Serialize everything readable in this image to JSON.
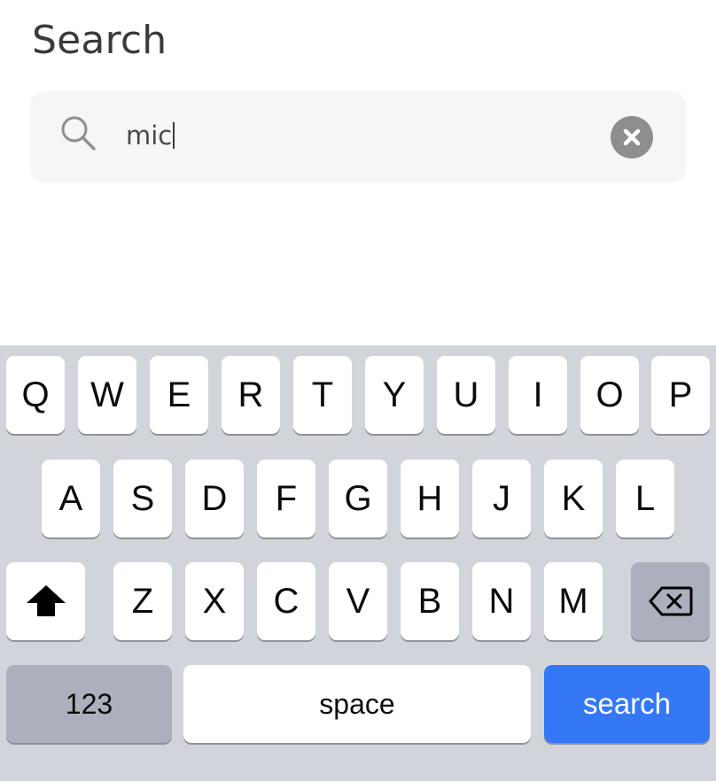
{
  "header": {
    "title": "Search"
  },
  "search": {
    "query": "mic"
  },
  "keyboard": {
    "row1": [
      "Q",
      "W",
      "E",
      "R",
      "T",
      "Y",
      "U",
      "I",
      "O",
      "P"
    ],
    "row2": [
      "A",
      "S",
      "D",
      "F",
      "G",
      "H",
      "J",
      "K",
      "L"
    ],
    "row3": [
      "Z",
      "X",
      "C",
      "V",
      "B",
      "N",
      "M"
    ],
    "numbers_label": "123",
    "space_label": "space",
    "search_label": "search"
  },
  "icons": {
    "search": "search-icon",
    "clear": "clear-icon",
    "shift": "shift-arrow-icon",
    "backspace": "backspace-icon"
  },
  "colors": {
    "keyboard_bg": "#d2d4dc",
    "key_bg": "#ffffff",
    "function_key_bg": "#abb0bc",
    "search_key_bg": "#3478f6",
    "search_bar_bg": "#f6f6f6"
  }
}
